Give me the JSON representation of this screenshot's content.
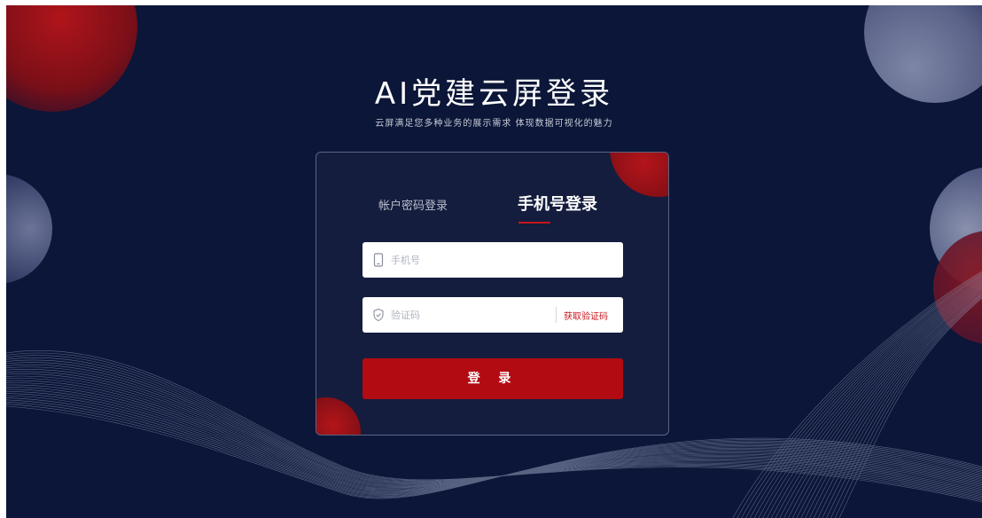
{
  "header": {
    "title": "AI党建云屏登录",
    "subtitle": "云屏满足您多种业务的展示需求 体现数据可视化的魅力"
  },
  "login": {
    "tabs": [
      {
        "label": "帐户密码登录",
        "active": false
      },
      {
        "label": "手机号登录",
        "active": true
      }
    ],
    "phone": {
      "placeholder": "手机号",
      "value": "",
      "icon": "mobile-phone-icon"
    },
    "code": {
      "placeholder": "验证码",
      "value": "",
      "icon": "shield-check-icon"
    },
    "get_code_label": "获取验证码",
    "submit_label": "登 录"
  },
  "colors": {
    "background": "#0b1638",
    "card": "#141d3d",
    "accent": "#c8161d",
    "button": "#b30b12"
  }
}
